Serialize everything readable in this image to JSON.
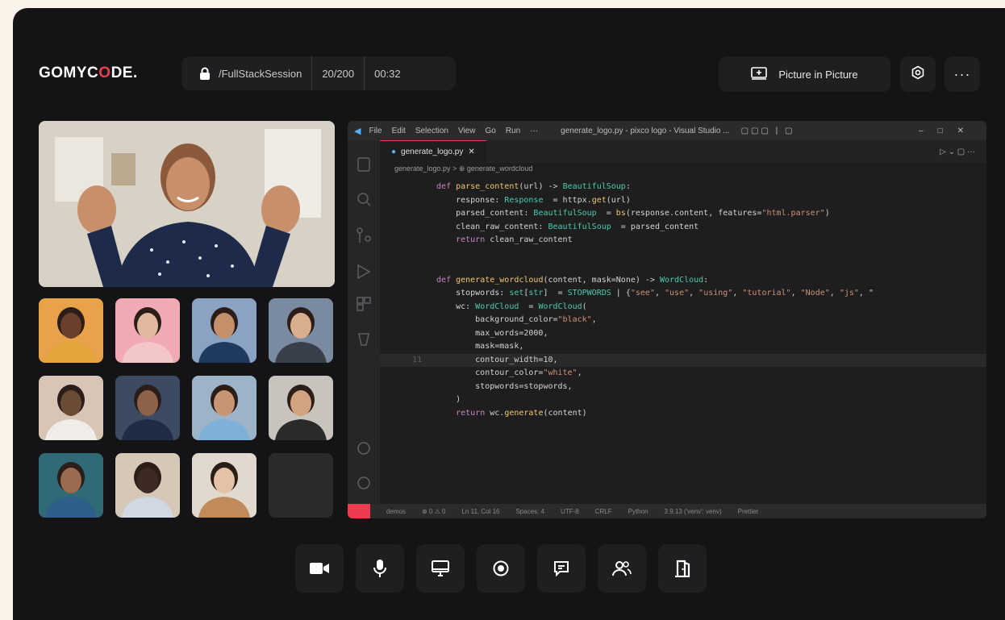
{
  "brand": {
    "logo_pre": "GOMYC",
    "logo_o": "O",
    "logo_post": "DE.",
    "accent": "#ef3b4f"
  },
  "session": {
    "name": "/FullStackSession",
    "participants": "20/200",
    "time": "00:32"
  },
  "header": {
    "pip_label": "Picture in Picture",
    "more_label": "···"
  },
  "vscode": {
    "title": "generate_logo.py - pixco logo - Visual Studio ...",
    "menu": [
      "File",
      "Edit",
      "Selection",
      "View",
      "Go",
      "Run",
      "···"
    ],
    "tab": "generate_logo.py",
    "breadcrumb": "generate_logo.py > ⊕ generate_wordcloud",
    "current_line": "11",
    "status": [
      "demos",
      "⊗ 0 ⚠ 0",
      "Ln 11, Col 16",
      "Spaces: 4",
      "UTF-8",
      "CRLF",
      "Python",
      "3.9.13 ('venv': venv)",
      "Prettier"
    ]
  },
  "code": [
    {
      "n": "",
      "t": "def parse_content(url) -> BeautifulSoup:"
    },
    {
      "n": "",
      "t": "    response: Response  = httpx.get(url)"
    },
    {
      "n": "",
      "t": "    parsed_content: BeautifulSoup  = bs(response.content, features=\"html.parser\")"
    },
    {
      "n": "",
      "t": "    clean_raw_content: BeautifulSoup  = parsed_content"
    },
    {
      "n": "",
      "t": "    return clean_raw_content"
    },
    {
      "n": "",
      "t": ""
    },
    {
      "n": "",
      "t": ""
    },
    {
      "n": "",
      "t": "def generate_wordcloud(content, mask=None) -> WordCloud:"
    },
    {
      "n": "",
      "t": "    stopwords: set[str]  = STOPWORDS | {\"see\", \"use\", \"using\", \"tutorial\", \"Node\", \"js\", \""
    },
    {
      "n": "",
      "t": "    wc: WordCloud  = WordCloud("
    },
    {
      "n": "",
      "t": "        background_color=\"black\","
    },
    {
      "n": "",
      "t": "        max_words=2000,"
    },
    {
      "n": "",
      "t": "        mask=mask,"
    },
    {
      "n": "11",
      "t": "        contour_width=10,"
    },
    {
      "n": "",
      "t": "        contour_color=\"white\","
    },
    {
      "n": "",
      "t": "        stopwords=stopwords,"
    },
    {
      "n": "",
      "t": "    )"
    },
    {
      "n": "",
      "t": "    return wc.generate(content)"
    }
  ],
  "controls": [
    "camera",
    "microphone",
    "screen-share",
    "record",
    "chat",
    "participants",
    "leave"
  ]
}
